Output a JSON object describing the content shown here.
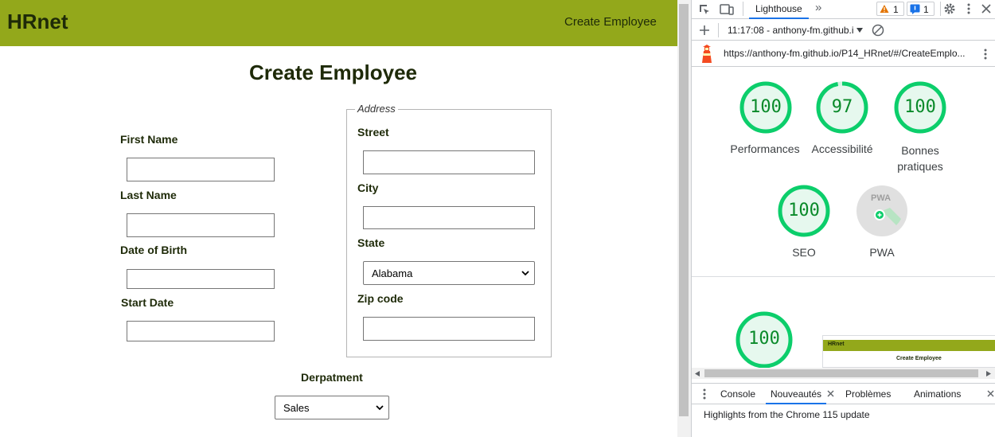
{
  "app": {
    "brand": "HRnet",
    "nav_link": "Create Employee",
    "title": "Create Employee",
    "fields": {
      "first_name": "First Name",
      "last_name": "Last Name",
      "date_of_birth": "Date of Birth",
      "start_date": "Start Date"
    },
    "address": {
      "legend": "Address",
      "street": "Street",
      "city": "City",
      "state": "State",
      "state_value": "Alabama",
      "zip": "Zip code"
    },
    "department": {
      "label": "Derpatment",
      "value": "Sales"
    }
  },
  "devtools": {
    "tabs": {
      "active": "Lighthouse",
      "more": "»"
    },
    "badges": {
      "warnings": "1",
      "messages": "1"
    },
    "report_selector": "11:17:08 - anthony-fm.github.i",
    "url": "https://anthony-fm.github.io/P14_HRnet/#/CreateEmplo...",
    "gauges": [
      {
        "score": "100",
        "label": "Performances"
      },
      {
        "score": "97",
        "label": "Accessibilité"
      },
      {
        "score": "100",
        "label": "Bonnes pratiques"
      },
      {
        "score": "100",
        "label": "SEO"
      },
      {
        "score": "",
        "label": "PWA",
        "badge": "PWA"
      }
    ],
    "detail_score": "100",
    "thumbnail": {
      "brand": "HRnet",
      "title": "Create Employee"
    },
    "drawer": {
      "tabs": [
        "Console",
        "Nouveautés",
        "Problèmes",
        "Animations"
      ],
      "active_tab": "Nouveautés",
      "content": "Highlights from the Chrome 115 update"
    },
    "colors": {
      "score_green": "#0cce6b",
      "score_text": "#0a8a2a",
      "accent": "#1a73e8"
    }
  }
}
